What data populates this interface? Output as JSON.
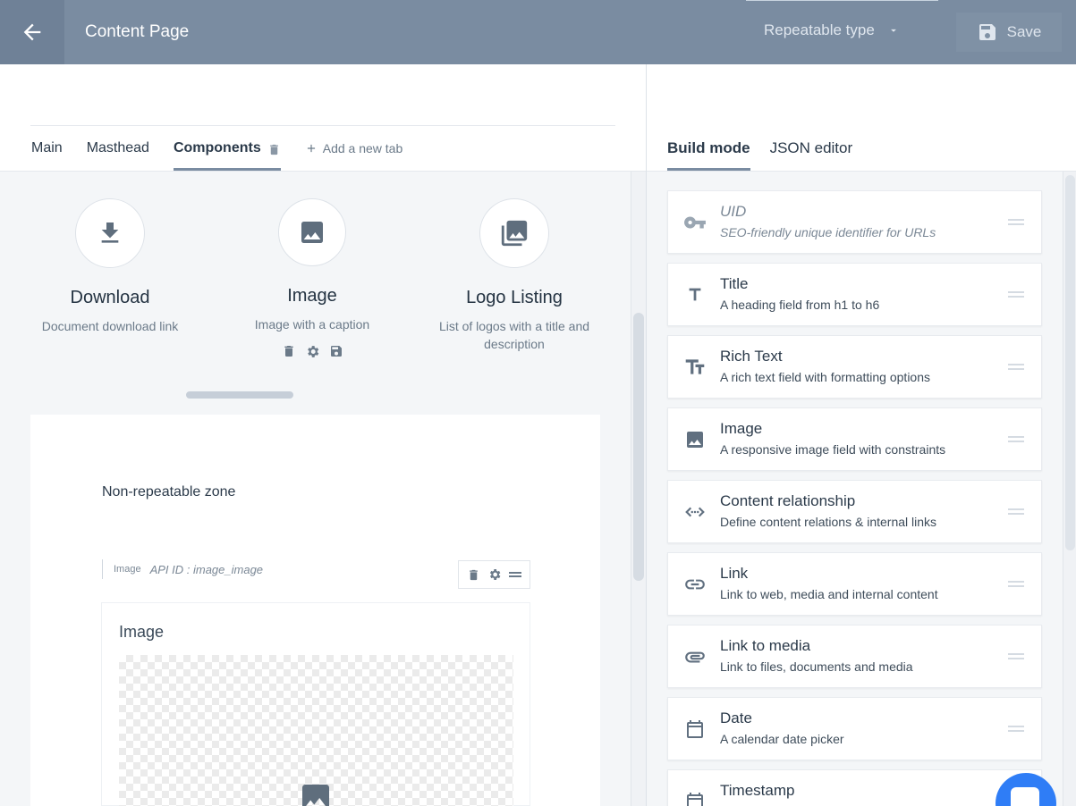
{
  "header": {
    "title": "Content Page",
    "type_selector": "Repeatable type",
    "save_label": "Save",
    "colors": {
      "bar": "#7a8ca1",
      "accent": "#2f7df6"
    }
  },
  "editor": {
    "tabs": [
      {
        "label": "Main"
      },
      {
        "label": "Masthead"
      },
      {
        "label": "Components"
      }
    ],
    "add_tab_label": "Add a new tab",
    "components": [
      {
        "title": "Download",
        "description": "Document download link",
        "icon": "download-icon"
      },
      {
        "title": "Image",
        "description": "Image with a caption",
        "icon": "image-icon"
      },
      {
        "title": "Logo Listing",
        "description": "List of logos with a title and description",
        "icon": "gallery-icon"
      }
    ],
    "zone": {
      "title": "Non-repeatable zone",
      "field_type": "Image",
      "api_id": "API ID : image_image",
      "card_title": "Image"
    }
  },
  "builder": {
    "modes": [
      {
        "label": "Build mode"
      },
      {
        "label": "JSON editor"
      }
    ],
    "fields": [
      {
        "name": "UID",
        "description": "SEO-friendly unique identifier for URLs",
        "icon": "key-icon"
      },
      {
        "name": "Title",
        "description": "A heading field from h1 to h6",
        "icon": "text-t-icon"
      },
      {
        "name": "Rich Text",
        "description": "A rich text field with formatting options",
        "icon": "rich-text-icon"
      },
      {
        "name": "Image",
        "description": "A responsive image field with constraints",
        "icon": "image-icon"
      },
      {
        "name": "Content relationship",
        "description": "Define content relations & internal links",
        "icon": "code-link-icon"
      },
      {
        "name": "Link",
        "description": "Link to web, media and internal content",
        "icon": "link-icon"
      },
      {
        "name": "Link to media",
        "description": "Link to files, documents and media",
        "icon": "paperclip-icon"
      },
      {
        "name": "Date",
        "description": "A calendar date picker",
        "icon": "calendar-icon"
      },
      {
        "name": "Timestamp",
        "description": "",
        "icon": "calendar-icon"
      }
    ]
  }
}
